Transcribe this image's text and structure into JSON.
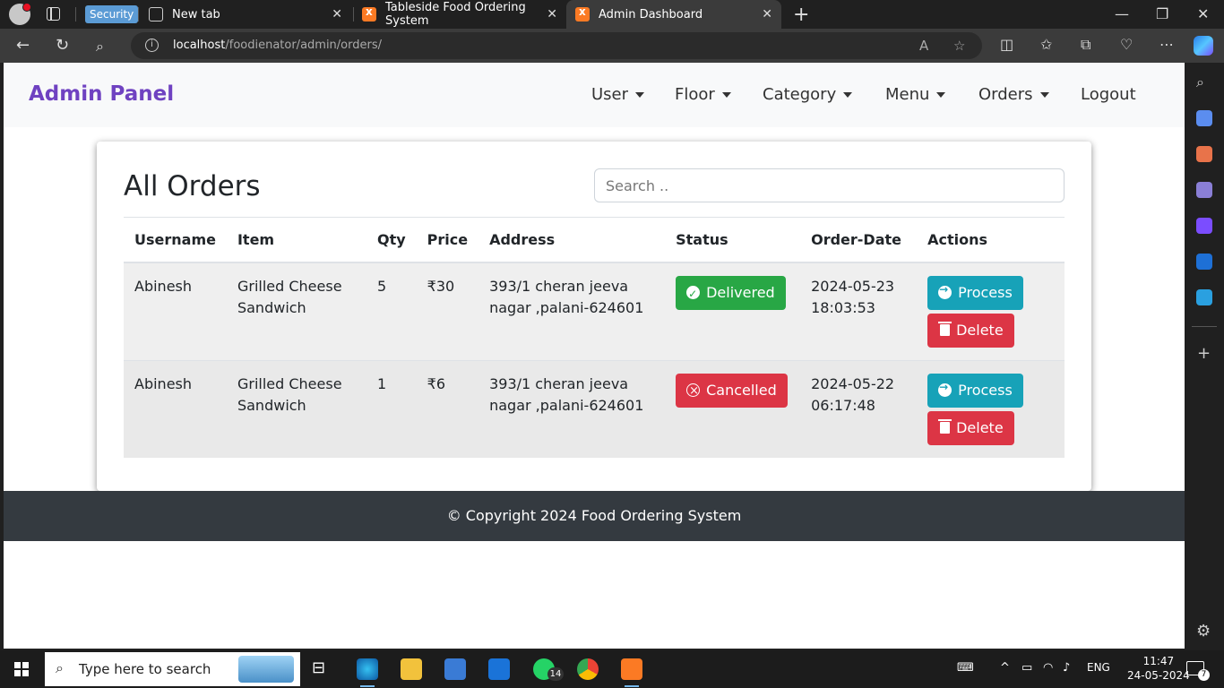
{
  "browser": {
    "security_badge": "Security",
    "tabs": [
      {
        "title": "New tab"
      },
      {
        "title": "Tableside Food Ordering System"
      },
      {
        "title": "Admin Dashboard"
      }
    ],
    "url_host": "localhost",
    "url_path": "/foodienator/admin/orders/"
  },
  "navbar": {
    "brand": "Admin Panel",
    "items": [
      {
        "label": "User"
      },
      {
        "label": "Floor"
      },
      {
        "label": "Category"
      },
      {
        "label": "Menu"
      },
      {
        "label": "Orders"
      }
    ],
    "logout": "Logout",
    "brand_color": "#6f42c1"
  },
  "orders": {
    "title": "All Orders",
    "search_placeholder": "Search ..",
    "columns": [
      "Username",
      "Item",
      "Qty",
      "Price",
      "Address",
      "Status",
      "Order-Date",
      "Actions"
    ],
    "rows": [
      {
        "username": "Abinesh",
        "item": "Grilled Cheese Sandwich",
        "qty": "5",
        "price": "₹30",
        "address": "393/1 cheran jeeva nagar ,palani-624601",
        "status": "Delivered",
        "order_date": "2024-05-23",
        "order_time": "18:03:53",
        "process_label": "Process",
        "delete_label": "Delete"
      },
      {
        "username": "Abinesh",
        "item": "Grilled Cheese Sandwich",
        "qty": "1",
        "price": "₹6",
        "address": "393/1 cheran jeeva nagar ,palani-624601",
        "status": "Cancelled",
        "order_date": "2024-05-22",
        "order_time": "06:17:48",
        "process_label": "Process",
        "delete_label": "Delete"
      }
    ]
  },
  "footer": {
    "text": "© Copyright 2024 Food Ordering System"
  },
  "taskbar": {
    "search_placeholder": "Type here to search",
    "whatsapp_badge": "14",
    "language": "ENG",
    "time": "11:47",
    "date": "24-05-2024",
    "notifications": "7"
  }
}
